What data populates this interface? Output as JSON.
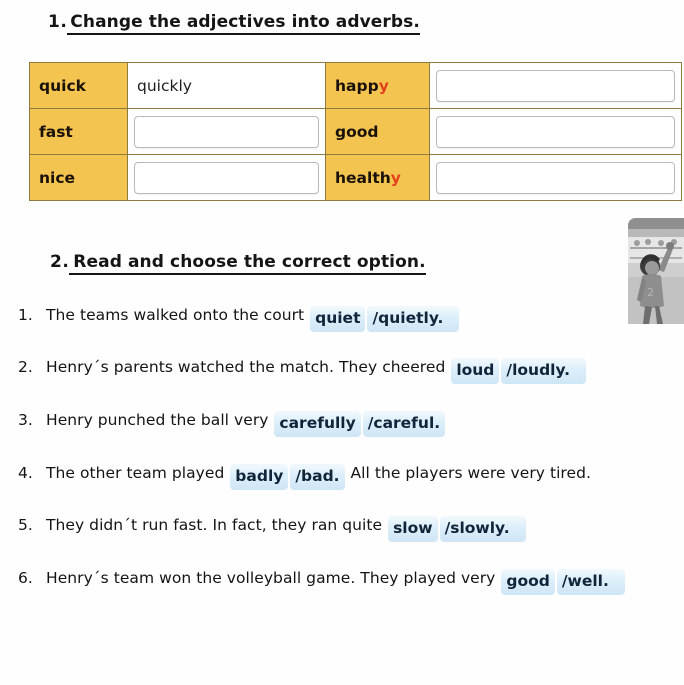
{
  "exercise1": {
    "number": "1.",
    "title": "Change the adjectives into adverbs.",
    "table": {
      "rows": [
        {
          "adj_left": "quick",
          "adj_left_suffix": "",
          "answer_left": "quickly",
          "answer_left_filled": true,
          "adj_right": "happ",
          "adj_right_suffix": "y",
          "answer_right": "",
          "answer_right_filled": false
        },
        {
          "adj_left": "fast",
          "adj_left_suffix": "",
          "answer_left": "",
          "answer_left_filled": false,
          "adj_right": "good",
          "adj_right_suffix": "",
          "answer_right": "",
          "answer_right_filled": false
        },
        {
          "adj_left": "nice",
          "adj_left_suffix": "",
          "answer_left": "",
          "answer_left_filled": false,
          "adj_right": "health",
          "adj_right_suffix": "y",
          "answer_right": "",
          "answer_right_filled": false
        }
      ]
    }
  },
  "exercise2": {
    "number": "2.",
    "title": "Read and choose the correct option.",
    "items": [
      {
        "index": "1.",
        "before": "The teams walked onto the court",
        "option_a": "quiet",
        "option_b": "/quietly.",
        "after": ""
      },
      {
        "index": "2.",
        "before": "Henry´s parents watched the match. They cheered",
        "option_a": "loud",
        "option_b": "/loudly.",
        "after": ""
      },
      {
        "index": "3.",
        "before": "Henry punched the ball very",
        "option_a": "carefully",
        "option_b": "/careful.",
        "after": ""
      },
      {
        "index": "4.",
        "before": "The other team played",
        "option_a": "badly",
        "option_b": "/bad.",
        "after": "All the players were very tired."
      },
      {
        "index": "5.",
        "before": "They didn´t run fast. In fact, they ran quite",
        "option_a": "slow",
        "option_b": "/slowly.",
        "after": ""
      },
      {
        "index": "6.",
        "before": "Henry´s team won the volleyball game. They played very",
        "option_a": "good",
        "option_b": "/well.",
        "after": ""
      }
    ]
  },
  "illustration": {
    "alt": "cheering-spectator-illustration"
  },
  "colors": {
    "table_header": "#f3c44f",
    "option_highlight": "#cfe6f6",
    "accent_red": "#e2411b"
  }
}
